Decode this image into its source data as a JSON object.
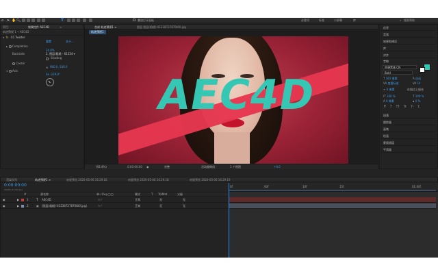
{
  "colors": {
    "accent": "#2d8ceb",
    "text_teal": "#36c7b4",
    "stripe": "#e5374f",
    "background_red": "#a3263a",
    "layer_red": "#c23b3b",
    "track_red": "#5e2a2a"
  },
  "toolbar": {
    "checkbox_label": "叠加打开面板",
    "workspace_tabs": [
      "必要项",
      "标准",
      "小屏幕",
      "库"
    ],
    "search_placeholder": "搜索帮助"
  },
  "effects_panel": {
    "tabs": [
      "项目",
      "效果控件 AEC4D"
    ],
    "tab_menu": "≡",
    "header": "轨迹预视 1 • AEC4D",
    "effect_name": "CC Twister",
    "reset_label": "重置",
    "about_label": "关于...",
    "props": [
      {
        "label": "Completion",
        "value": "24.0%"
      },
      {
        "label": "Backside",
        "value": "2. 图层(粗糙 - 61234 ▾"
      },
      {
        "label": "",
        "value": "Shading"
      },
      {
        "label": "Center",
        "value": "960.0, 540.0"
      },
      {
        "label": "Axis",
        "value": "0x -229.0°"
      }
    ]
  },
  "composition": {
    "tabs": [
      "合成 轨迹预视1 ≡",
      "图层 图层(粗糙)-61238727876t00.jpg"
    ],
    "breadcrumb": "轨迹预视1",
    "overlay_text": "AEC4D",
    "viewer_bar": {
      "zoom": "(92.4%)",
      "timecode": "0:00:00:00",
      "quality": "完整",
      "camera": "活动摄像机",
      "views": "1 个视图",
      "exposure": "+0.0"
    }
  },
  "right_panel": {
    "items_top": [
      "信息",
      "音频",
      "效果和预设",
      "库",
      "对齐"
    ],
    "character": {
      "title": "字符",
      "font_name": "思源黑体 CN",
      "font_style": "Bold",
      "font_size": "181 像素",
      "leading": "自动",
      "kerning": "度量标准",
      "tracking": "14",
      "stroke_width": "0 像素",
      "stroke_type": "在描边上填充",
      "vertical_scale": "100 %",
      "horizontal_scale": "100 %",
      "baseline_shift": "0 像素",
      "tsume": "0 %",
      "style_buttons": [
        "T",
        "T",
        "TT",
        "Tt",
        "T¹",
        "T,"
      ]
    },
    "items_bottom": [
      "段落",
      "跟踪器",
      "画笔",
      "绘画",
      "蒙版插值",
      "平滑器"
    ]
  },
  "timeline": {
    "tabs": [
      "渲染队列",
      "轨迹预视1 ≡",
      "房屋预览 2020-05-06 16.29.16",
      "房屋预览 2020-05-06 16.29.18",
      "房屋预览 2020-05-06 16.29.19"
    ],
    "timecode": "0:00:00:00",
    "fps_label": "00000 (25.00 fps)",
    "columns": [
      "#",
      "源名称",
      "单☆\\fx◎◯◯",
      "模式",
      "T",
      "TrkMat",
      "父级"
    ],
    "ruler": [
      "0f",
      "00f",
      "10f",
      "15f",
      "01:00f"
    ],
    "layers": [
      {
        "num": "1",
        "type": "T",
        "name": "AEC4D",
        "mode": "正常",
        "trkmat": "无",
        "parent": "无"
      },
      {
        "num": "2",
        "type": "▣",
        "name": "[图层(粗糙)-61238727876t00.jpg]",
        "mode": "正常",
        "trkmat": "无",
        "parent": "无"
      }
    ]
  }
}
